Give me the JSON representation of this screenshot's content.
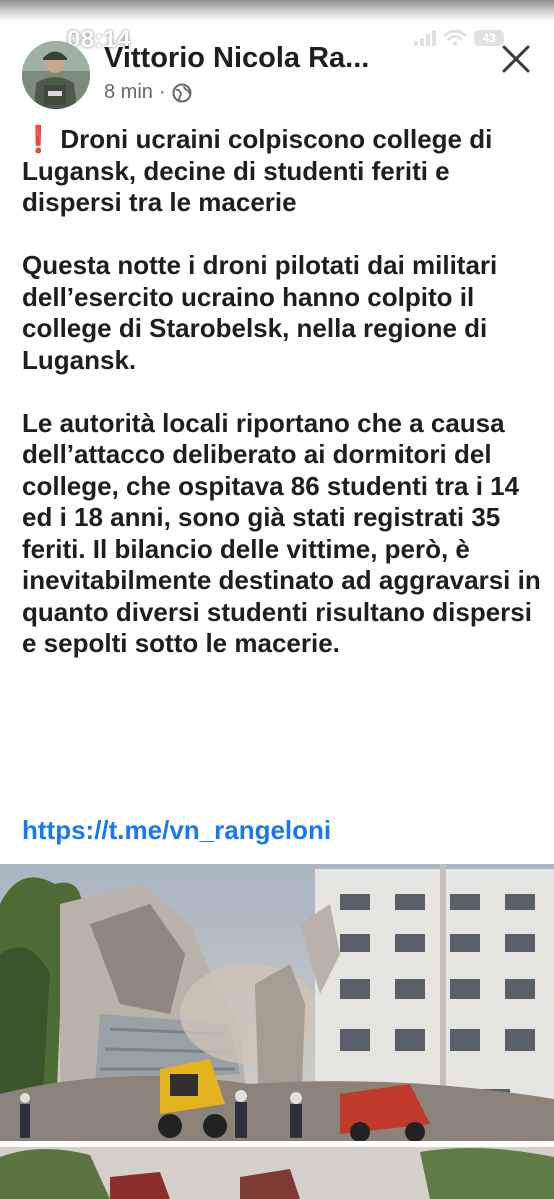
{
  "status": {
    "time": "08:14",
    "battery": "43"
  },
  "post": {
    "author": "Vittorio Nicola Ra...",
    "time": "8 min",
    "separator": "·",
    "headline": "Droni ucraini colpiscono college di Lugansk, decine di studenti feriti e dispersi tra le macerie",
    "paragraph1": "Questa notte i droni pilotati dai militari dell’esercito ucraino hanno colpito il college di Starobelsk, nella regione di Lugansk.",
    "paragraph2": "Le autorità locali riportano che a causa dell’attacco deliberato ai dormitori del college, che ospitava 86 studenti tra i 14 ed i 18 anni, sono già stati registrati 35 feriti. Il bilancio delle vittime, però, è inevitabilmente destinato ad aggravarsi in quanto diversi studenti risultano dispersi e sepolti sotto le macerie.",
    "link": "https://t.me/vn_rangeloni"
  },
  "icons": {
    "globe": "globe-icon",
    "close": "close-icon",
    "alert": "exclamation-icon",
    "signal": "signal-icon",
    "wifi": "wifi-icon"
  },
  "colors": {
    "text": "#1c1e21",
    "secondary": "#65676b",
    "link": "#1877f2",
    "alert": "#e0245e"
  }
}
